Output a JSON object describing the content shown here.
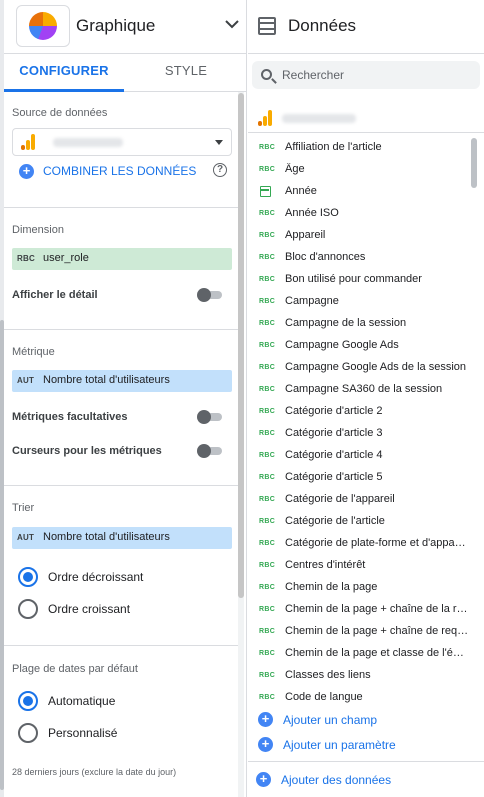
{
  "left_panel": {
    "chart_type": "Graphique",
    "tabs": [
      "CONFIGURER",
      "STYLE"
    ],
    "data_source": {
      "section_title": "Source de données",
      "combine_label": "COMBINER LES DONNÉES",
      "help_icon": "?"
    },
    "dimension": {
      "section_title": "Dimension",
      "chip_type": "RBC",
      "chip_label": "user_role",
      "drill_down_label": "Afficher le détail"
    },
    "metric": {
      "section_title": "Métrique",
      "chip_type": "AUT",
      "chip_label": "Nombre total d'utilisateurs",
      "optional_metrics_label": "Métriques facultatives",
      "metric_sliders_label": "Curseurs pour les métriques"
    },
    "sort": {
      "section_title": "Trier",
      "chip_type": "AUT",
      "chip_label": "Nombre total d'utilisateurs",
      "options": [
        "Ordre décroissant",
        "Ordre croissant"
      ],
      "selected": "Ordre décroissant"
    },
    "date_range": {
      "section_title": "Plage de dates par défaut",
      "options": [
        "Automatique",
        "Personnalisé"
      ],
      "selected": "Automatique",
      "note": "28 derniers jours (exclure la date du jour)"
    }
  },
  "right_panel": {
    "title": "Données",
    "search_placeholder": "Rechercher",
    "field_type_label": "RBC",
    "fields": [
      "Affiliation de l'article",
      "Âge",
      "Année",
      "Année ISO",
      "Appareil",
      "Bloc d'annonces",
      "Bon utilisé pour commander",
      "Campagne",
      "Campagne de la session",
      "Campagne Google Ads",
      "Campagne Google Ads de la session",
      "Campagne SA360 de la session",
      "Catégorie d'article 2",
      "Catégorie d'article 3",
      "Catégorie d'article 4",
      "Catégorie d'article 5",
      "Catégorie de l'appareil",
      "Catégorie de l'article",
      "Catégorie de plate-forme et d'appareil",
      "Centres d'intérêt",
      "Chemin de la page",
      "Chemin de la page + chaîne de la re…",
      "Chemin de la page + chaîne de requ…",
      "Chemin de la page et classe de l'écran",
      "Classes des liens",
      "Code de langue"
    ],
    "add_field_label": "Ajouter un champ",
    "add_parameter_label": "Ajouter un paramètre",
    "add_data_label": "Ajouter des données"
  },
  "colors": {
    "accent": "#1a73e8",
    "dimension_chip": "#ceead6",
    "metric_chip": "#c2e0fb",
    "field_type_green": "#34a853"
  }
}
